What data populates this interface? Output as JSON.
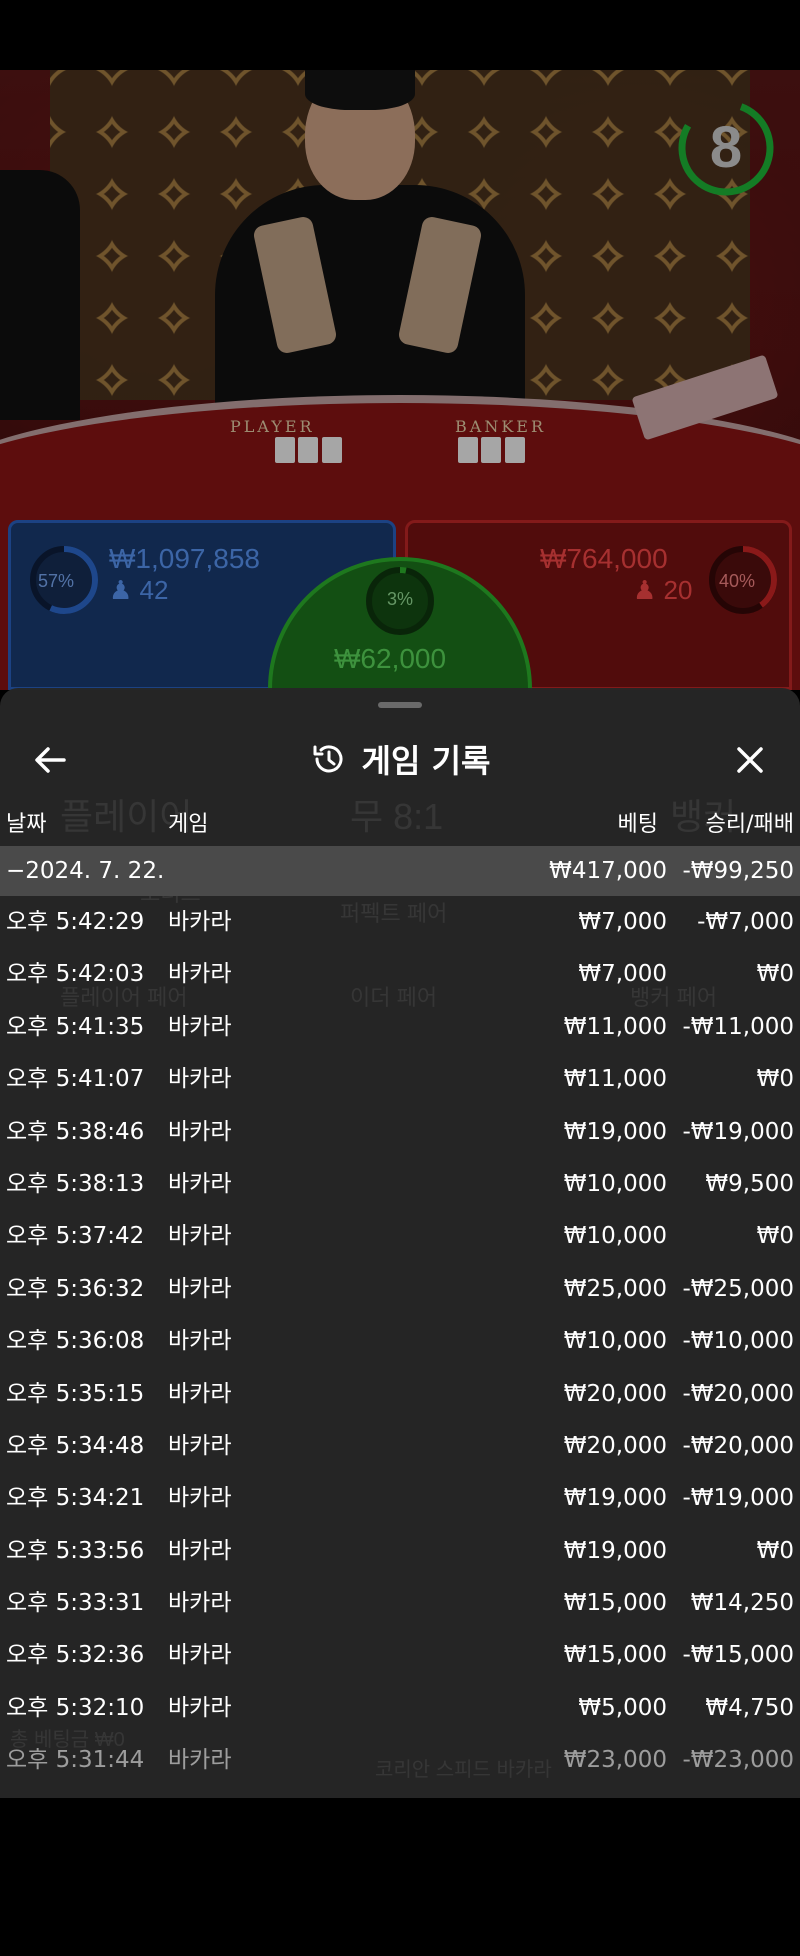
{
  "game_view": {
    "timer_value": "8",
    "table_labels": {
      "player": "PLAYER",
      "banker": "BANKER"
    },
    "player_side": {
      "percent": "57%",
      "total_bet": "₩1,097,858",
      "bettors": "42",
      "percent_value": 57
    },
    "banker_side": {
      "percent": "40%",
      "total_bet": "₩764,000",
      "bettors": "20",
      "percent_value": 40
    },
    "tie": {
      "percent": "3%",
      "total_bet": "₩62,000"
    },
    "colors": {
      "player": "#2f6ed6",
      "banker": "#d42727",
      "tie": "#2fb82f",
      "timer": "#1fbf3a"
    }
  },
  "sheet": {
    "title": "게임 기록",
    "columns": {
      "date": "날짜",
      "game": "게임",
      "bet": "베팅",
      "result": "승리/패배"
    },
    "date_group": {
      "label": "−2024. 7. 22.",
      "bet_total": "₩417,000",
      "result_total": "-₩99,250"
    },
    "rows": [
      {
        "time": "오후 5:42:29",
        "game": "바카라",
        "bet": "₩7,000",
        "result": "-₩7,000"
      },
      {
        "time": "오후 5:42:03",
        "game": "바카라",
        "bet": "₩7,000",
        "result": "₩0"
      },
      {
        "time": "오후 5:41:35",
        "game": "바카라",
        "bet": "₩11,000",
        "result": "-₩11,000"
      },
      {
        "time": "오후 5:41:07",
        "game": "바카라",
        "bet": "₩11,000",
        "result": "₩0"
      },
      {
        "time": "오후 5:38:46",
        "game": "바카라",
        "bet": "₩19,000",
        "result": "-₩19,000"
      },
      {
        "time": "오후 5:38:13",
        "game": "바카라",
        "bet": "₩10,000",
        "result": "₩9,500"
      },
      {
        "time": "오후 5:37:42",
        "game": "바카라",
        "bet": "₩10,000",
        "result": "₩0"
      },
      {
        "time": "오후 5:36:32",
        "game": "바카라",
        "bet": "₩25,000",
        "result": "-₩25,000"
      },
      {
        "time": "오후 5:36:08",
        "game": "바카라",
        "bet": "₩10,000",
        "result": "-₩10,000"
      },
      {
        "time": "오후 5:35:15",
        "game": "바카라",
        "bet": "₩20,000",
        "result": "-₩20,000"
      },
      {
        "time": "오후 5:34:48",
        "game": "바카라",
        "bet": "₩20,000",
        "result": "-₩20,000"
      },
      {
        "time": "오후 5:34:21",
        "game": "바카라",
        "bet": "₩19,000",
        "result": "-₩19,000"
      },
      {
        "time": "오후 5:33:56",
        "game": "바카라",
        "bet": "₩19,000",
        "result": "₩0"
      },
      {
        "time": "오후 5:33:31",
        "game": "바카라",
        "bet": "₩15,000",
        "result": "₩14,250"
      },
      {
        "time": "오후 5:32:36",
        "game": "바카라",
        "bet": "₩15,000",
        "result": "-₩15,000"
      },
      {
        "time": "오후 5:32:10",
        "game": "바카라",
        "bet": "₩5,000",
        "result": "₩4,750"
      },
      {
        "time": "오후 5:31:44",
        "game": "바카라",
        "bet": "₩23,000",
        "result": "-₩23,000"
      }
    ],
    "background_ghost_text": {
      "player_label": "플레이어",
      "tie_label": "무 8:1",
      "banker_label": "뱅커",
      "side1": "보너스",
      "side2": "퍼펙트 페어",
      "side3": "플레이어 페어",
      "side4": "이더 페어",
      "side5": "뱅커 페어",
      "total_bet": "총 베팅금 ₩0",
      "table_name": "코리안 스피드 바카라"
    }
  }
}
